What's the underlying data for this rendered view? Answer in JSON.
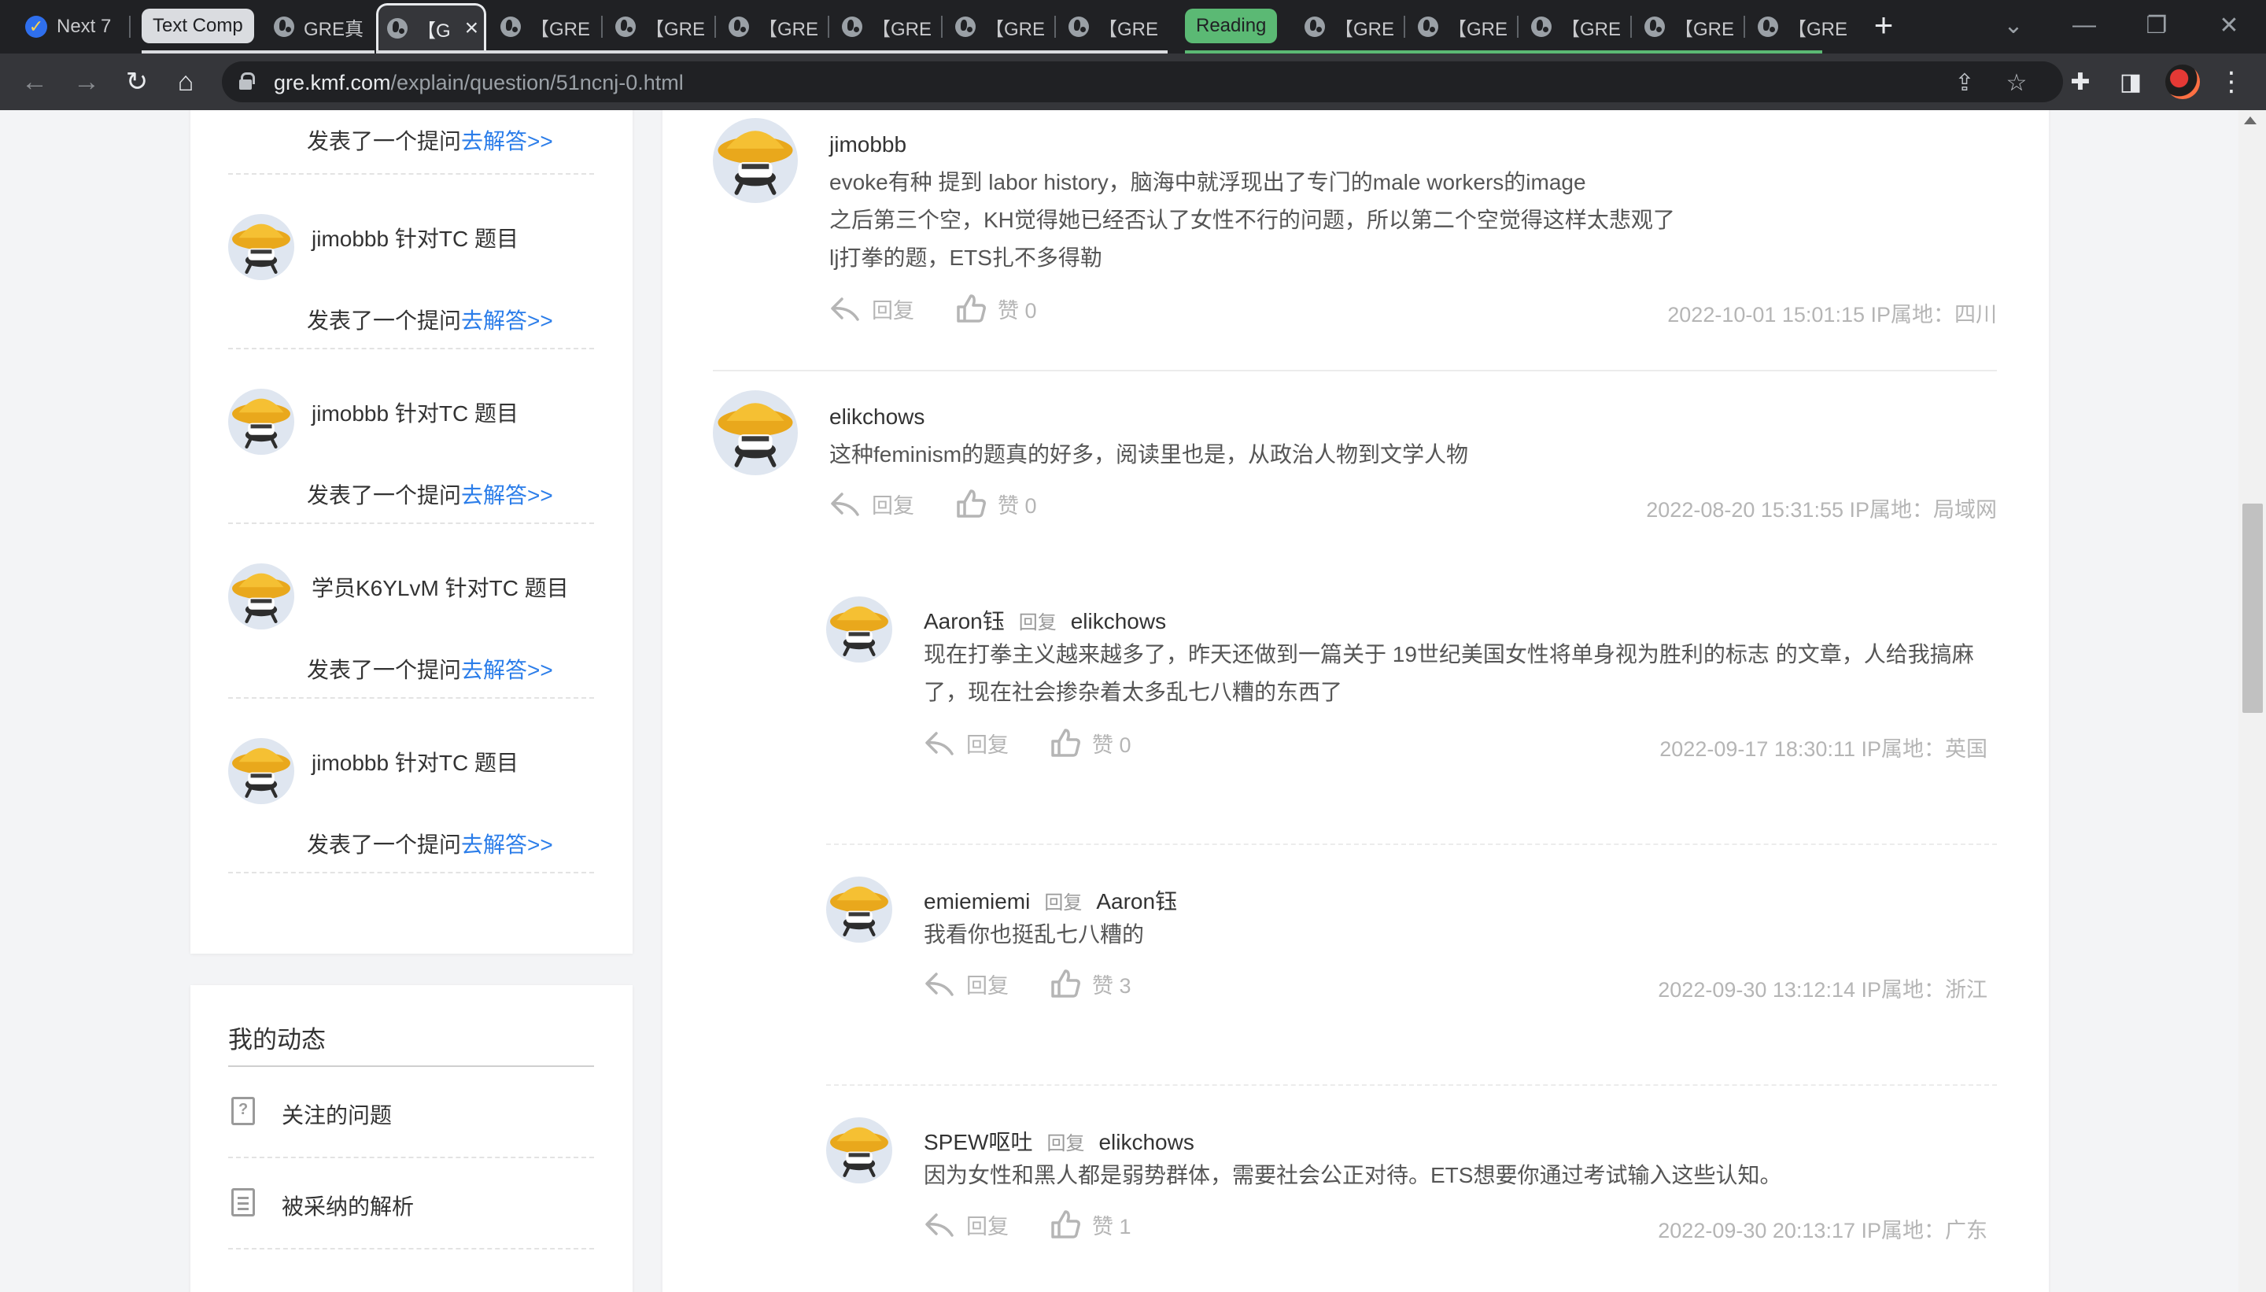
{
  "browser": {
    "tabs": [
      {
        "label": "Next 7"
      },
      {
        "label": "GRE真"
      },
      {
        "label": "【G"
      },
      {
        "label": "【GRE"
      },
      {
        "label": "【GRE"
      },
      {
        "label": "【GRE"
      },
      {
        "label": "【GRE"
      },
      {
        "label": "【GRE"
      },
      {
        "label": "【GRE"
      },
      {
        "label": "【GRE"
      },
      {
        "label": "【GRE"
      },
      {
        "label": "【GRE"
      },
      {
        "label": "【GRE"
      },
      {
        "label": "【GRE"
      }
    ],
    "groups": {
      "grey": "Text Comp",
      "green": "Reading"
    },
    "new_tab": "+",
    "url_host": "gre.kmf.com",
    "url_path": "/explain/question/51ncnj-0.html"
  },
  "sidebar": {
    "activity": [
      {
        "head": "",
        "action": "发表了一个提问",
        "link": "去解答>>"
      },
      {
        "head": "jimobbb 针对TC 题目",
        "action": "发表了一个提问",
        "link": "去解答>>"
      },
      {
        "head": "jimobbb 针对TC 题目",
        "action": "发表了一个提问",
        "link": "去解答>>"
      },
      {
        "head": "学员K6YLvM 针对TC 题目",
        "action": "发表了一个提问",
        "link": "去解答>>"
      },
      {
        "head": "jimobbb 针对TC 题目",
        "action": "发表了一个提问",
        "link": "去解答>>"
      }
    ],
    "my_dynamics_title": "我的动态",
    "my_dynamics": [
      {
        "label": "关注的问题"
      },
      {
        "label": "被采纳的解析"
      }
    ]
  },
  "comments": [
    {
      "user": "jimobbb",
      "lines": [
        "evoke有种 提到 labor history，脑海中就浮现出了专门的male workers的image",
        "之后第三个空，KH觉得她已经否认了女性不行的问题，所以第二个空觉得这样太悲观了",
        "lj打拳的题，ETS扎不多得勒"
      ],
      "reply": "回复",
      "like": "赞 0",
      "meta": "2022-10-01 15:01:15  IP属地：四川"
    },
    {
      "user": "elikchows",
      "lines": [
        "这种feminism的题真的好多，阅读里也是，从政治人物到文学人物"
      ],
      "reply": "回复",
      "like": "赞 0",
      "meta": "2022-08-20 15:31:55  IP属地：局域网"
    },
    {
      "user": "Aaron钰",
      "reply_word": "回复",
      "target": "elikchows",
      "lines": [
        "现在打拳主义越来越多了，昨天还做到一篇关于 19世纪美国女性将单身视为胜利的标志 的文章，人给我搞麻",
        "了，现在社会掺杂着太多乱七八糟的东西了"
      ],
      "reply": "回复",
      "like": "赞 0",
      "meta": "2022-09-17 18:30:11  IP属地：英国"
    },
    {
      "user": "emiemiemi",
      "reply_word": "回复",
      "target": "Aaron钰",
      "lines": [
        "我看你也挺乱七八糟的"
      ],
      "reply": "回复",
      "like": "赞 3",
      "meta": "2022-09-30 13:12:14  IP属地：浙江"
    },
    {
      "user": "SPEW呕吐",
      "reply_word": "回复",
      "target": "elikchows",
      "lines": [
        "因为女性和黑人都是弱势群体，需要社会公正对待。ETS想要你通过考试输入这些认知。"
      ],
      "reply": "回复",
      "like": "赞 1",
      "meta": "2022-09-30 20:13:17  IP属地：广东"
    }
  ],
  "colors": {
    "link": "#2b7de9",
    "avatar_hat": "#f0b323",
    "avatar_face": "#3a3a3a",
    "avatar_bg": "#dfe6f0"
  }
}
